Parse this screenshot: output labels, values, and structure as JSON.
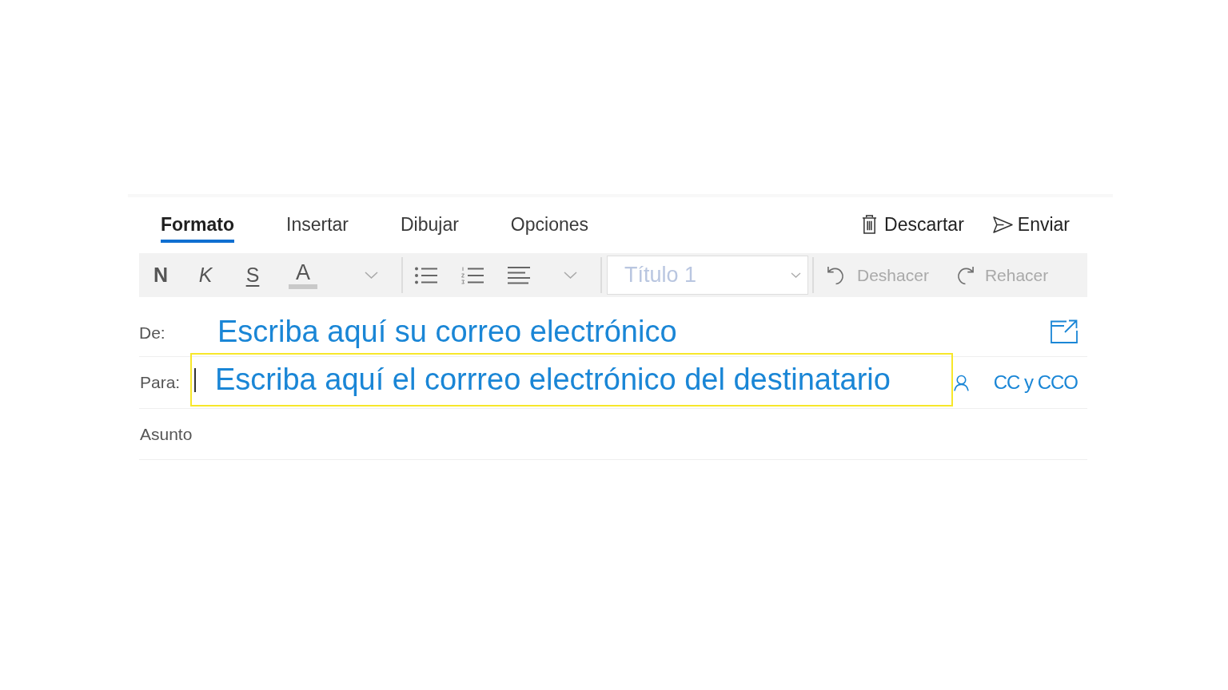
{
  "tabs": [
    {
      "label": "Formato",
      "selected": true
    },
    {
      "label": "Insertar",
      "selected": false
    },
    {
      "label": "Dibujar",
      "selected": false
    },
    {
      "label": "Opciones",
      "selected": false
    }
  ],
  "actions": [
    {
      "kind": "discard",
      "label": "Descartar"
    },
    {
      "kind": "send",
      "label": "Enviar"
    }
  ],
  "toolbar": [
    {
      "kind": "bold",
      "label": "N"
    },
    {
      "kind": "italic",
      "label": "K"
    },
    {
      "kind": "underline",
      "label": "S"
    },
    {
      "kind": "font-color",
      "label": "A"
    },
    {
      "kind": "more"
    },
    {
      "kind": "separator"
    },
    {
      "kind": "bullets"
    },
    {
      "kind": "numbering"
    },
    {
      "kind": "align"
    },
    {
      "kind": "more"
    },
    {
      "kind": "separator"
    },
    {
      "kind": "style",
      "value": "Título 1",
      "disabled": true
    },
    {
      "kind": "separator"
    },
    {
      "kind": "undo",
      "label": "Deshacer",
      "disabled": true
    },
    {
      "kind": "redo",
      "label": "Rehacer",
      "disabled": true
    }
  ],
  "from": {
    "label": "De:",
    "value": "Escriba aquí su correo electrónico"
  },
  "to": {
    "label": "Para:",
    "value": "Escriba aquí el corrreo electrónico del destinatario",
    "highlighted": true,
    "focused": true,
    "cc_bcc": "CC y CCO"
  },
  "subject": {
    "placeholder": "Asunto"
  }
}
